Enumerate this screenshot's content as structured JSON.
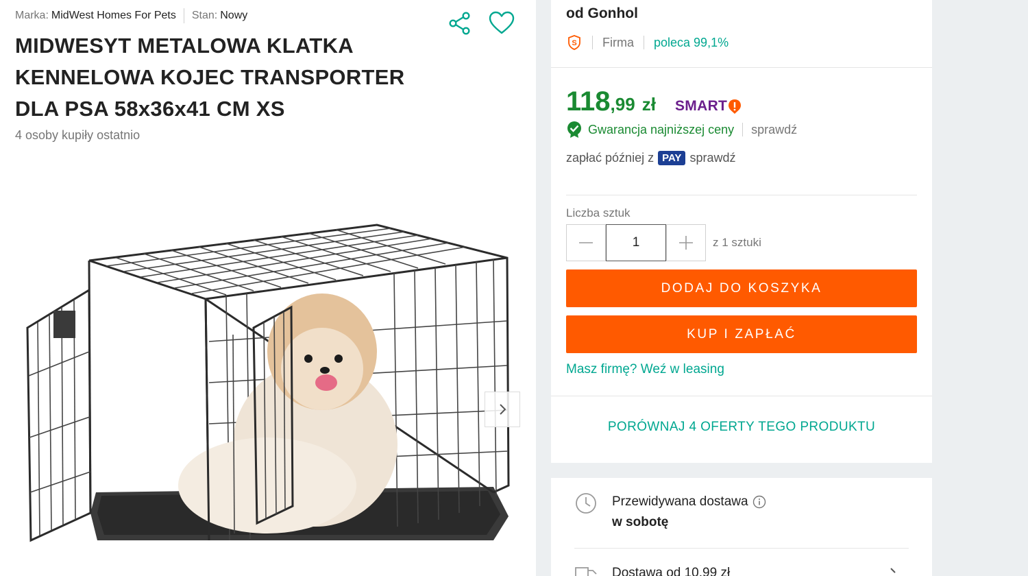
{
  "product": {
    "brand_label": "Marka:",
    "brand_value": "MidWest Homes For Pets",
    "condition_label": "Stan:",
    "condition_value": "Nowy",
    "title": "MIDWESYT METALOWA KLATKA KENNELOWA KOJEC TRANSPORTER DLA PSA 58x36x41 CM XS",
    "recent_buyers": "4 osoby kupiły ostatnio",
    "icons": {
      "share": "share-icon",
      "favorite": "heart-icon",
      "next": "chevron-right-icon"
    }
  },
  "seller": {
    "name": "od Gonhol",
    "type": "Firma",
    "recommend": "poleca 99,1%",
    "icon": "super-seller-icon"
  },
  "price": {
    "integer": "118",
    "decimal": ",99",
    "currency": "zł",
    "smart": "SMART",
    "guarantee": "Gwarancja najniższej ceny",
    "guarantee_check": "sprawdź",
    "pay_later_prefix": "zapłać później z",
    "pay_badge": "PAY",
    "pay_check": "sprawdź"
  },
  "quantity": {
    "label": "Liczba sztuk",
    "value": "1",
    "of_units": "z 1 sztuki"
  },
  "actions": {
    "add_to_cart": "DODAJ DO KOSZYKA",
    "buy_now": "KUP I ZAPŁAĆ",
    "leasing": "Masz firmę? Weź w leasing",
    "compare": "PORÓWNAJ 4 OFERTY TEGO PRODUKTU"
  },
  "delivery": {
    "title": "Przewidywana dostawa",
    "day": "w sobotę",
    "cost": "Dostawa od 10,99 zł"
  },
  "colors": {
    "accent_orange": "#ff5a00",
    "price_green": "#1a8a32",
    "teal_link": "#00a790",
    "smart_purple": "#6b1f8c",
    "pay_blue": "#1c3f94"
  }
}
